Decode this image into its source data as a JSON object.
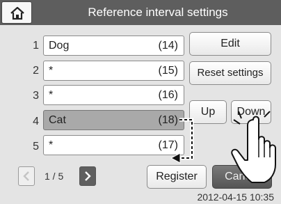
{
  "header": {
    "title": "Reference interval settings",
    "home_icon": "home-icon"
  },
  "list": {
    "items": [
      {
        "index": "1",
        "name": "Dog",
        "count": "(14)",
        "selected": false
      },
      {
        "index": "2",
        "name": "*",
        "count": "(15)",
        "selected": false
      },
      {
        "index": "3",
        "name": "*",
        "count": "(16)",
        "selected": false
      },
      {
        "index": "4",
        "name": "Cat",
        "count": "(18)",
        "selected": true
      },
      {
        "index": "5",
        "name": "*",
        "count": "(17)",
        "selected": false
      }
    ]
  },
  "buttons": {
    "edit": "Edit",
    "reset": "Reset settings",
    "up": "Up",
    "down": "Down",
    "register": "Register",
    "cancel": "Cancel"
  },
  "pager": {
    "text": "1 / 5",
    "prev_icon": "chevron-left-icon",
    "next_icon": "chevron-right-icon"
  },
  "status": {
    "timestamp": "2012-04-15 10:35"
  },
  "colors": {
    "titlebar": "#5e5e5e",
    "selected_row": "#a9a9a9",
    "background": "#e4e4e4"
  }
}
